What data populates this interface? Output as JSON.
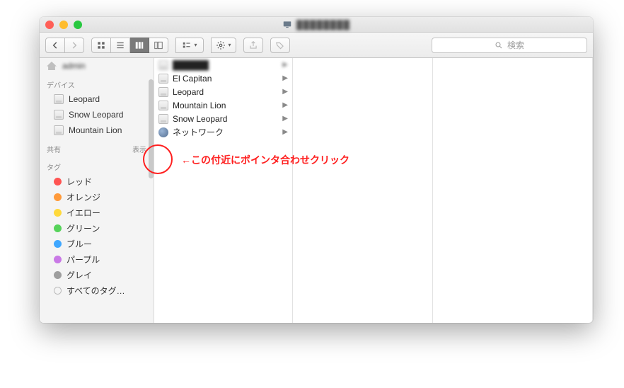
{
  "window": {
    "title_blurred": "████████"
  },
  "search": {
    "placeholder": "検索"
  },
  "sidebar": {
    "top_item_blurred": "admin",
    "devices_header": "デバイス",
    "devices": [
      {
        "label": "Leopard"
      },
      {
        "label": "Snow Leopard"
      },
      {
        "label": "Mountain Lion"
      }
    ],
    "shared_header": "共有",
    "shared_show_label": "表示",
    "tags_header": "タグ",
    "tags": [
      {
        "label": "レッド",
        "color": "#ff5452"
      },
      {
        "label": "オレンジ",
        "color": "#ff9a3a"
      },
      {
        "label": "イエロー",
        "color": "#ffd93b"
      },
      {
        "label": "グリーン",
        "color": "#56d35a"
      },
      {
        "label": "ブルー",
        "color": "#3fa7ff"
      },
      {
        "label": "パープル",
        "color": "#c979e6"
      },
      {
        "label": "グレイ",
        "color": "#9e9e9e"
      }
    ],
    "all_tags_label": "すべてのタグ…"
  },
  "column1": {
    "items": [
      {
        "label": "██████",
        "blurred": true,
        "icon": "disk",
        "arrow": true
      },
      {
        "label": "El Capitan",
        "icon": "disk",
        "arrow": true
      },
      {
        "label": "Leopard",
        "icon": "disk",
        "arrow": true
      },
      {
        "label": "Mountain Lion",
        "icon": "disk",
        "arrow": true
      },
      {
        "label": "Snow Leopard",
        "icon": "disk",
        "arrow": true
      },
      {
        "label": "ネットワーク",
        "icon": "network",
        "arrow": true
      }
    ]
  },
  "annotation": {
    "text": "←この付近にポインタ合わせクリック"
  },
  "icons": {
    "monitor": "monitor-icon",
    "search": "search-icon"
  }
}
